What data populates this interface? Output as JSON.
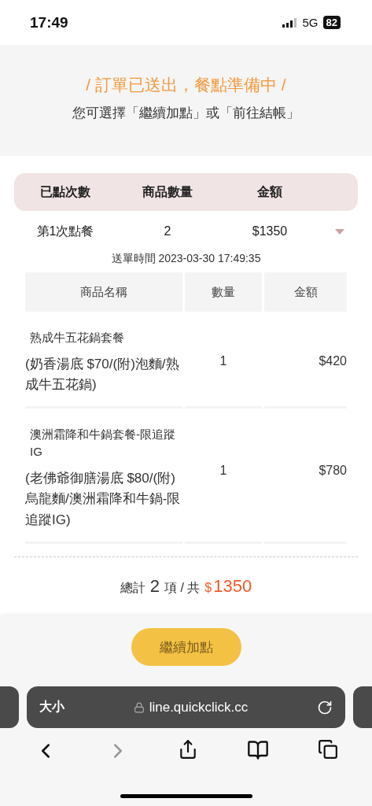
{
  "status_bar": {
    "time": "17:49",
    "network": "5G",
    "battery": "82"
  },
  "header": {
    "title": "/ 訂單已送出，餐點準備中 /",
    "subtitle": "您可選擇「繼續加點」或「前往結帳」"
  },
  "summary": {
    "columns": [
      "已點次數",
      "商品數量",
      "金額"
    ],
    "orders": [
      {
        "label": "第1次點餐",
        "count": "2",
        "amount": "$1350",
        "expanded": true,
        "sent_time": "送單時間 2023-03-30 17:49:35",
        "items_table": {
          "columns": [
            "商品名稱",
            "數量",
            "金額"
          ],
          "rows": [
            {
              "name": "熟成牛五花鍋套餐",
              "detail": "(奶香湯底 $70/(附)泡麵/熟成牛五花鍋)",
              "qty": "1",
              "amount": "$420"
            },
            {
              "name": "澳洲霜降和牛鍋套餐-限追蹤IG",
              "detail": "(老佛爺御膳湯底 $80/(附)烏龍麵/澳洲霜降和牛鍋-限追蹤IG)",
              "qty": "1",
              "amount": "$780"
            }
          ]
        }
      }
    ]
  },
  "total": {
    "prefix": "總計",
    "count": "2",
    "middle": "項 / 共",
    "currency": "$",
    "amount": "1350"
  },
  "action_button": "繼續加點",
  "browser": {
    "text_size": "大小",
    "url": "line.quickclick.cc"
  }
}
